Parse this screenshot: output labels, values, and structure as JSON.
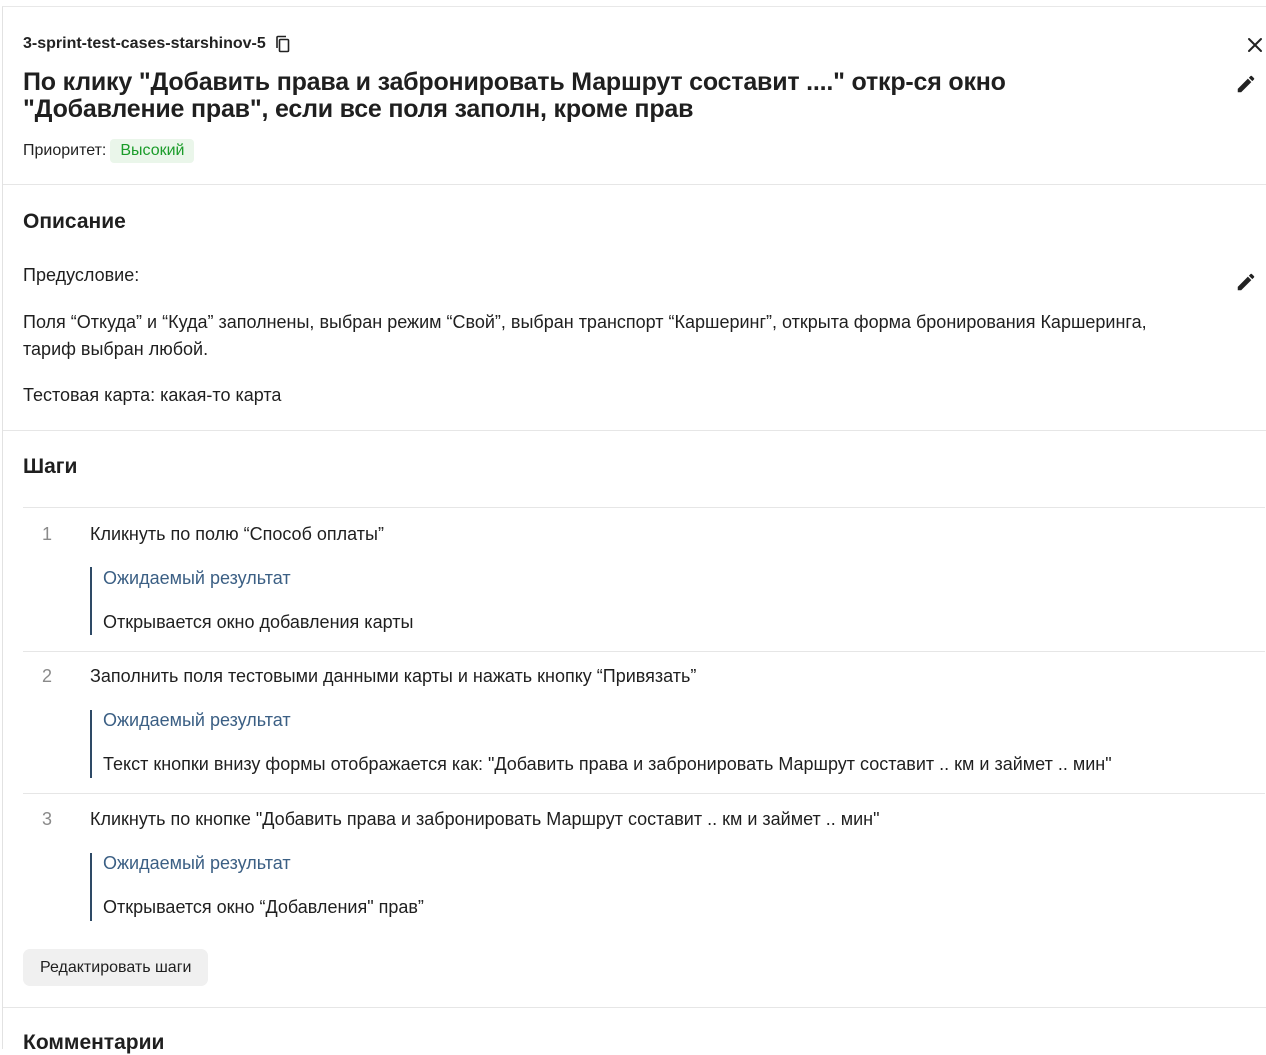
{
  "header": {
    "case_id": "3-sprint-test-cases-starshinov-5",
    "title": "По клику \"Добавить права и забронировать Маршрут составит ....\" откр-ся окно \"Добавление прав\", если все поля заполн, кроме прав",
    "priority_label": "Приоритет:",
    "priority_value": "Высокий"
  },
  "description": {
    "heading": "Описание",
    "precondition_label": "Предусловие:",
    "precondition_text": "Поля “Откуда” и “Куда” заполнены, выбран режим “Свой”, выбран транспорт “Каршеринг”, открыта форма бронирования Каршеринга, тариф выбран любой.",
    "test_card": "Тестовая карта: какая-то карта"
  },
  "steps": {
    "heading": "Шаги",
    "expected_label": "Ожидаемый результат",
    "items": [
      {
        "number": "1",
        "action": "Кликнуть по полю “Способ оплаты”",
        "expected": "Открывается окно добавления карты"
      },
      {
        "number": "2",
        "action": "Заполнить поля тестовыми данными карты и нажать кнопку “Привязать”",
        "expected": "Текст кнопки внизу формы отображается как: \"Добавить права и забронировать Маршрут составит .. км и займет .. мин\""
      },
      {
        "number": "3",
        "action": "Кликнуть по кнопке \"Добавить права и забронировать Маршрут составит .. км и займет .. мин\"",
        "expected": "Открывается окно “Добавления\" прав”"
      }
    ],
    "edit_button": "Редактировать шаги"
  },
  "comments": {
    "heading": "Комментарии"
  },
  "colors": {
    "priority_high": "#1b9c2a",
    "expected_label": "#3b5f84",
    "accent_bar": "#2e4a66"
  }
}
